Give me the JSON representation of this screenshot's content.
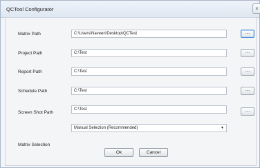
{
  "window": {
    "title": "QCTool Configurator",
    "close_glyph": "×"
  },
  "fields": [
    {
      "label": "Matrix Path",
      "value": "C:\\Users\\Naveen\\Desktop\\QCTest",
      "browse": "...."
    },
    {
      "label": "Project Path",
      "value": "C:\\Test",
      "browse": "...."
    },
    {
      "label": "Report Path",
      "value": "C:\\Test",
      "browse": "...."
    },
    {
      "label": "Schedule Path",
      "value": "C:\\Test",
      "browse": "...."
    },
    {
      "label": "Screen Shot Path",
      "value": "C:\\Test",
      "browse": "...."
    }
  ],
  "matrix_selection": {
    "label": "Matrix Selection",
    "selected": "Manual Selection (Recommended)",
    "arrow": "▾"
  },
  "buttons": {
    "ok": "Ok",
    "cancel": "Cancel"
  },
  "icons": {
    "close": "close-icon",
    "dropdown": "chevron-down-icon"
  },
  "colors": {
    "focus_border": "#4d8fd6",
    "title_bar": "#dfe7f1"
  }
}
